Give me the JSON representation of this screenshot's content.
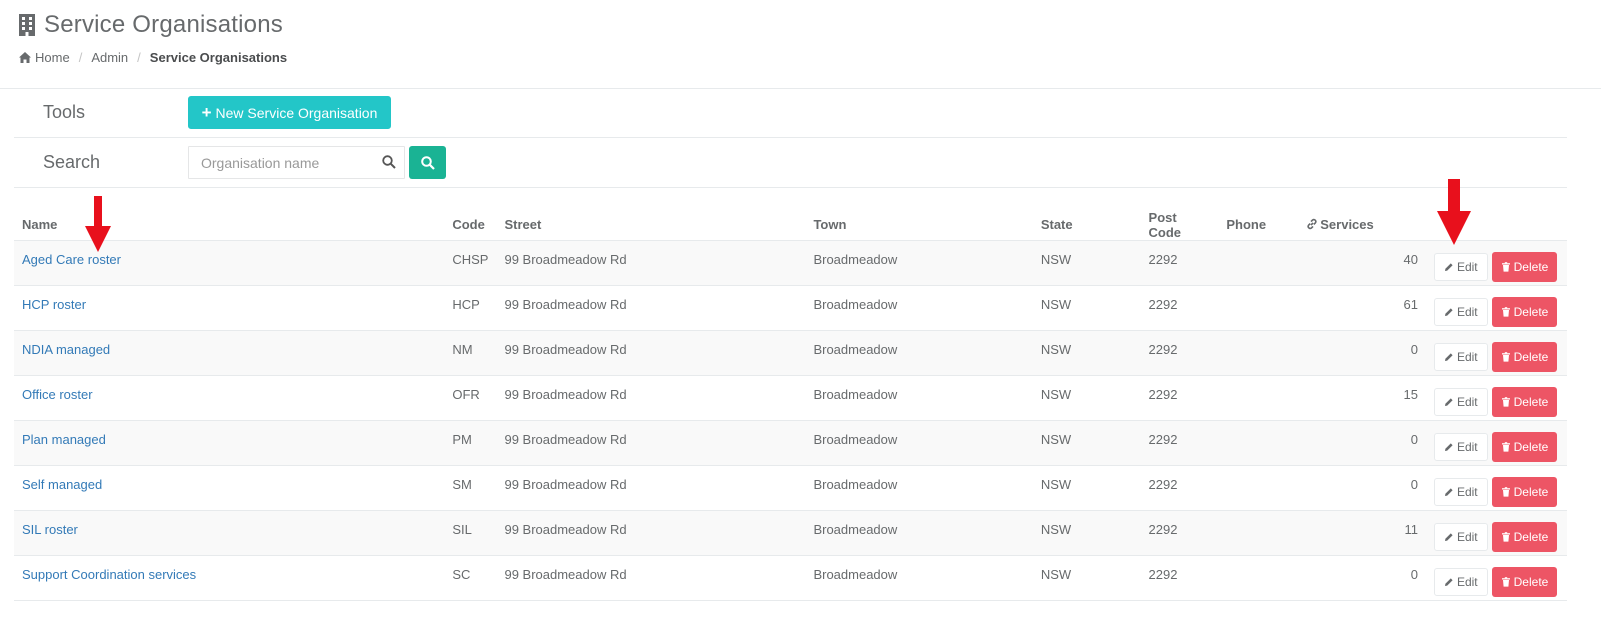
{
  "header": {
    "title": "Service Organisations",
    "icon": "building-icon",
    "breadcrumb": {
      "home": "Home",
      "admin": "Admin",
      "current": "Service Organisations"
    }
  },
  "tools": {
    "label": "Tools",
    "new_button": "New Service Organisation"
  },
  "search": {
    "label": "Search",
    "placeholder": "Organisation name"
  },
  "table": {
    "columns": {
      "name": "Name",
      "code": "Code",
      "street": "Street",
      "town": "Town",
      "state": "State",
      "post_code": "Post Code",
      "phone": "Phone",
      "services": "Services"
    },
    "rows": [
      {
        "name": "Aged Care roster",
        "code": "CHSP",
        "street": "99 Broadmeadow Rd",
        "town": "Broadmeadow",
        "state": "NSW",
        "post_code": "2292",
        "phone": "",
        "services": "40"
      },
      {
        "name": "HCP roster",
        "code": "HCP",
        "street": "99 Broadmeadow Rd",
        "town": "Broadmeadow",
        "state": "NSW",
        "post_code": "2292",
        "phone": "",
        "services": "61"
      },
      {
        "name": "NDIA managed",
        "code": "NM",
        "street": "99 Broadmeadow Rd",
        "town": "Broadmeadow",
        "state": "NSW",
        "post_code": "2292",
        "phone": "",
        "services": "0"
      },
      {
        "name": "Office roster",
        "code": "OFR",
        "street": "99 Broadmeadow Rd",
        "town": "Broadmeadow",
        "state": "NSW",
        "post_code": "2292",
        "phone": "",
        "services": "15"
      },
      {
        "name": "Plan managed",
        "code": "PM",
        "street": "99 Broadmeadow Rd",
        "town": "Broadmeadow",
        "state": "NSW",
        "post_code": "2292",
        "phone": "",
        "services": "0"
      },
      {
        "name": "Self managed",
        "code": "SM",
        "street": "99 Broadmeadow Rd",
        "town": "Broadmeadow",
        "state": "NSW",
        "post_code": "2292",
        "phone": "",
        "services": "0"
      },
      {
        "name": "SIL roster",
        "code": "SIL",
        "street": "99 Broadmeadow Rd",
        "town": "Broadmeadow",
        "state": "NSW",
        "post_code": "2292",
        "phone": "",
        "services": "11"
      },
      {
        "name": "Support Coordination services",
        "code": "SC",
        "street": "99 Broadmeadow Rd",
        "town": "Broadmeadow",
        "state": "NSW",
        "post_code": "2292",
        "phone": "",
        "services": "0"
      }
    ],
    "edit_label": "Edit",
    "delete_label": "Delete"
  },
  "colors": {
    "accent_info": "#23c6c8",
    "accent_primary": "#1ab394",
    "danger": "#ed5565",
    "link": "#337ab7",
    "annotation_arrow": "#e8101c"
  }
}
